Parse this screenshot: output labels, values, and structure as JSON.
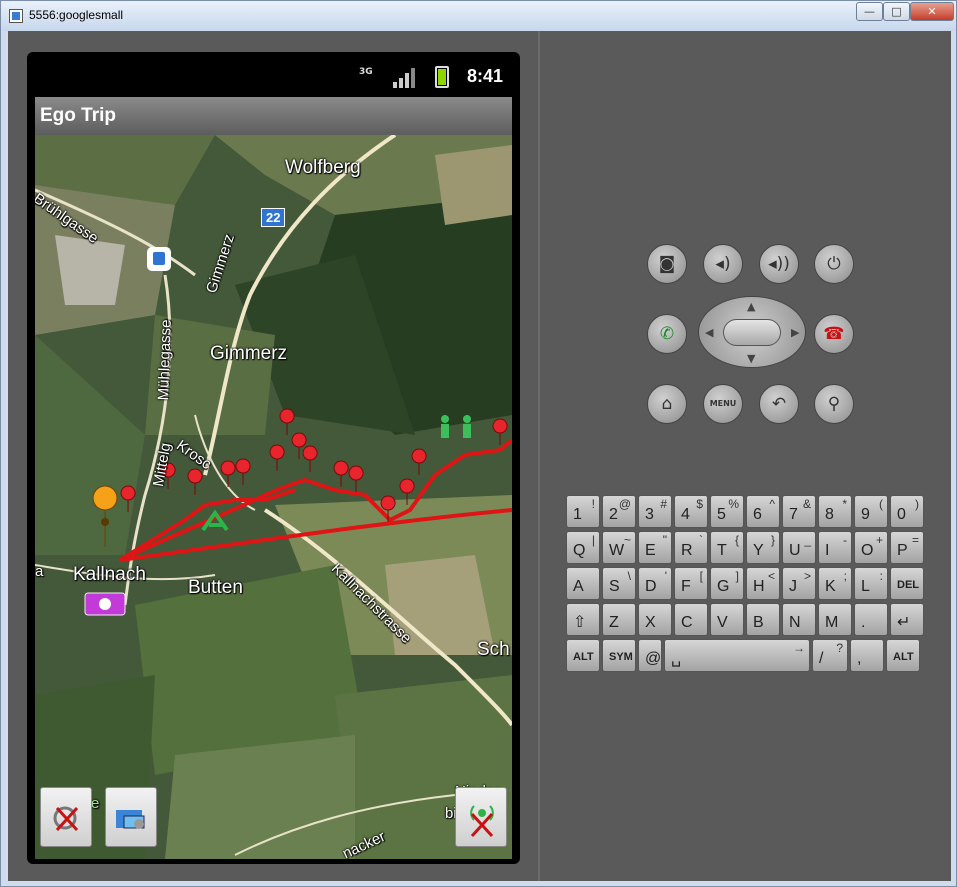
{
  "window": {
    "title": "5556:googlesmall",
    "minimize": "—",
    "maximize": "□",
    "close": "✕"
  },
  "status_bar": {
    "network": "3G",
    "time": "8:41"
  },
  "app": {
    "title": "Ego Trip"
  },
  "map": {
    "labels": {
      "wolfberg": "Wolfberg",
      "gimmerz": "Gimmerz",
      "gimmerz_street": "Gimmerz",
      "bruhlgasse": "Brühlgasse",
      "muhlegasse": "Mühlegasse",
      "mittelgasse": "Mittelg",
      "krosch": "Krosc",
      "kallnach": "Kallnach",
      "butten": "Butten",
      "kallnachstrasse": "Kallnachstrasse",
      "sch": "Sch",
      "nacker": "nacker",
      "nieder": "Nieder",
      "bi": "bi",
      "edge_e": "e",
      "edge_a": "a"
    },
    "road_shield": "22"
  },
  "controls": {
    "camera": "camera-icon",
    "volume_down": "volume-down-icon",
    "volume_up": "volume-up-icon",
    "power": "power-icon",
    "call": "call-icon",
    "end_call": "end-call-icon",
    "home": "home-icon",
    "menu": "MENU",
    "back": "back-icon",
    "search": "search-icon"
  },
  "keyboard": {
    "row1": [
      {
        "k": "1",
        "a": "!"
      },
      {
        "k": "2",
        "a": "@"
      },
      {
        "k": "3",
        "a": "#"
      },
      {
        "k": "4",
        "a": "$"
      },
      {
        "k": "5",
        "a": "%"
      },
      {
        "k": "6",
        "a": "^"
      },
      {
        "k": "7",
        "a": "&"
      },
      {
        "k": "8",
        "a": "*"
      },
      {
        "k": "9",
        "a": "("
      },
      {
        "k": "0",
        "a": ")"
      }
    ],
    "row2": [
      {
        "k": "Q",
        "a": "|"
      },
      {
        "k": "W",
        "a": "~"
      },
      {
        "k": "E",
        "a": "\""
      },
      {
        "k": "R",
        "a": "`"
      },
      {
        "k": "T",
        "a": "{"
      },
      {
        "k": "Y",
        "a": "}"
      },
      {
        "k": "U",
        "a": "_"
      },
      {
        "k": "I",
        "a": "-"
      },
      {
        "k": "O",
        "a": "+"
      },
      {
        "k": "P",
        "a": "="
      }
    ],
    "row3": [
      {
        "k": "A",
        "a": ""
      },
      {
        "k": "S",
        "a": "\\"
      },
      {
        "k": "D",
        "a": "'"
      },
      {
        "k": "F",
        "a": "["
      },
      {
        "k": "G",
        "a": "]"
      },
      {
        "k": "H",
        "a": "<"
      },
      {
        "k": "J",
        "a": ">"
      },
      {
        "k": "K",
        "a": ";"
      },
      {
        "k": "L",
        "a": ":"
      },
      {
        "k": "DEL",
        "a": ""
      }
    ],
    "row4": [
      {
        "k": "⇧",
        "a": ""
      },
      {
        "k": "Z",
        "a": ""
      },
      {
        "k": "X",
        "a": ""
      },
      {
        "k": "C",
        "a": ""
      },
      {
        "k": "V",
        "a": ""
      },
      {
        "k": "B",
        "a": ""
      },
      {
        "k": "N",
        "a": ""
      },
      {
        "k": "M",
        "a": ""
      },
      {
        "k": ".",
        "a": ""
      },
      {
        "k": "↵",
        "a": ""
      }
    ],
    "row5": [
      {
        "k": "ALT",
        "a": ""
      },
      {
        "k": "SYM",
        "a": ""
      },
      {
        "k": "@",
        "a": ""
      },
      {
        "k": "␣",
        "a": "→"
      },
      {
        "k": "/",
        "a": "?"
      },
      {
        "k": ",",
        "a": ""
      },
      {
        "k": "ALT",
        "a": ""
      }
    ]
  }
}
